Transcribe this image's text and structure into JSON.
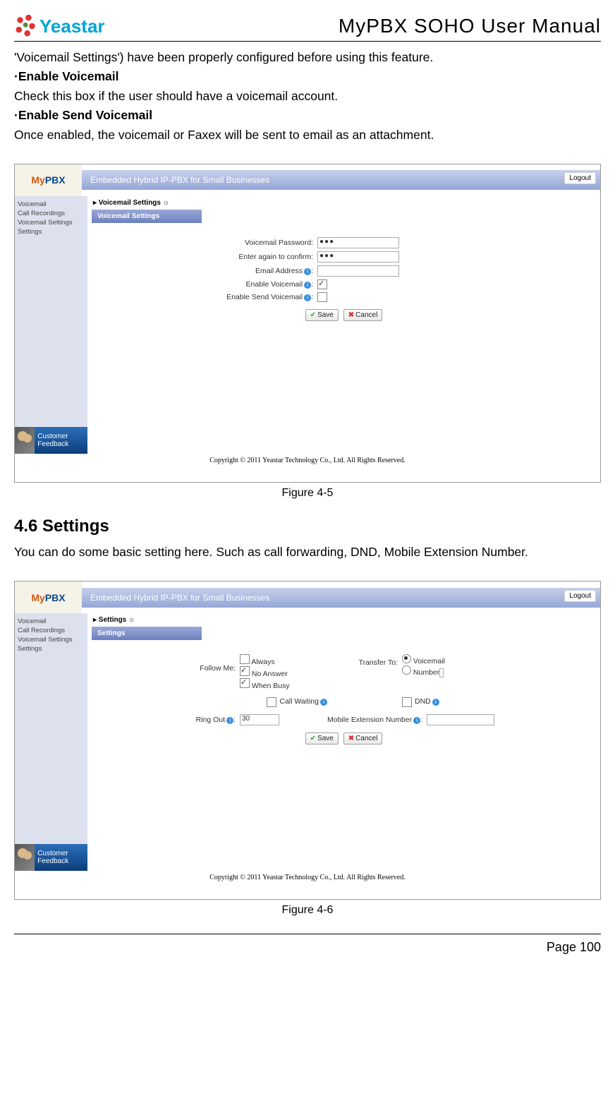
{
  "header": {
    "brand": "Yeastar",
    "title": "MyPBX SOHO User Manual"
  },
  "body": {
    "intro_fragment": "'Voicemail Settings') have been properly configured before using this feature.",
    "enable_vm_label": "·Enable Voicemail",
    "enable_vm_text": "Check this box if the user should have a voicemail account.",
    "enable_send_vm_label": "·Enable Send Voicemail",
    "enable_send_vm_text": "Once enabled, the voicemail or Faxex will be sent to email as an attachment."
  },
  "screenshot1": {
    "app_logo": "MyPBX",
    "tagline": "Embedded Hybrid IP-PBX for Small Businesses",
    "logout": "Logout",
    "sidebar": [
      "Voicemail",
      "Call Recordings",
      "Voicemail Settings",
      "Settings"
    ],
    "feedback": "Customer Feedback",
    "breadcrumb": "▸ Voicemail Settings ☼",
    "panel_title": "Voicemail Settings",
    "fields": {
      "pw_label": "Voicemail Password:",
      "pw_value": "●●●",
      "confirm_label": "Enter again to confirm:",
      "confirm_value": "●●●",
      "email_label": "Email Address",
      "enable_vm_label": "Enable Voicemail",
      "enable_send_label": "Enable Send Voicemail"
    },
    "buttons": {
      "save": "Save",
      "cancel": "Cancel"
    },
    "copyright": "Copyright © 2011 Yeastar Technology Co., Ltd. All Rights Reserved.",
    "caption": "Figure 4-5"
  },
  "section": {
    "heading": "4.6 Settings",
    "text": "You can do some basic setting here. Such as call forwarding, DND, Mobile Extension Number."
  },
  "screenshot2": {
    "app_logo": "MyPBX",
    "tagline": "Embedded Hybrid IP-PBX for Small Businesses",
    "logout": "Logout",
    "sidebar": [
      "Voicemail",
      "Call Recordings",
      "Voicemail Settings",
      "Settings"
    ],
    "feedback": "Customer Feedback",
    "breadcrumb": "▸ Settings ☼",
    "panel_title": "Settings",
    "follow_me_label": "Follow Me:",
    "follow_me_options": {
      "always": "Always",
      "no_answer": "No Answer",
      "when_busy": "When Busy"
    },
    "transfer_to_label": "Transfer To:",
    "transfer_options": {
      "voicemail": "Voicemail",
      "number": "Number"
    },
    "call_waiting_label": "Call Waiting",
    "dnd_label": "DND",
    "ring_out_label": "Ring Out",
    "ring_out_value": "30",
    "mobile_ext_label": "Mobile Extension Number",
    "buttons": {
      "save": "Save",
      "cancel": "Cancel"
    },
    "copyright": "Copyright © 2011 Yeastar Technology Co., Ltd. All Rights Reserved.",
    "caption": "Figure 4-6"
  },
  "footer": {
    "page": "Page 100"
  }
}
